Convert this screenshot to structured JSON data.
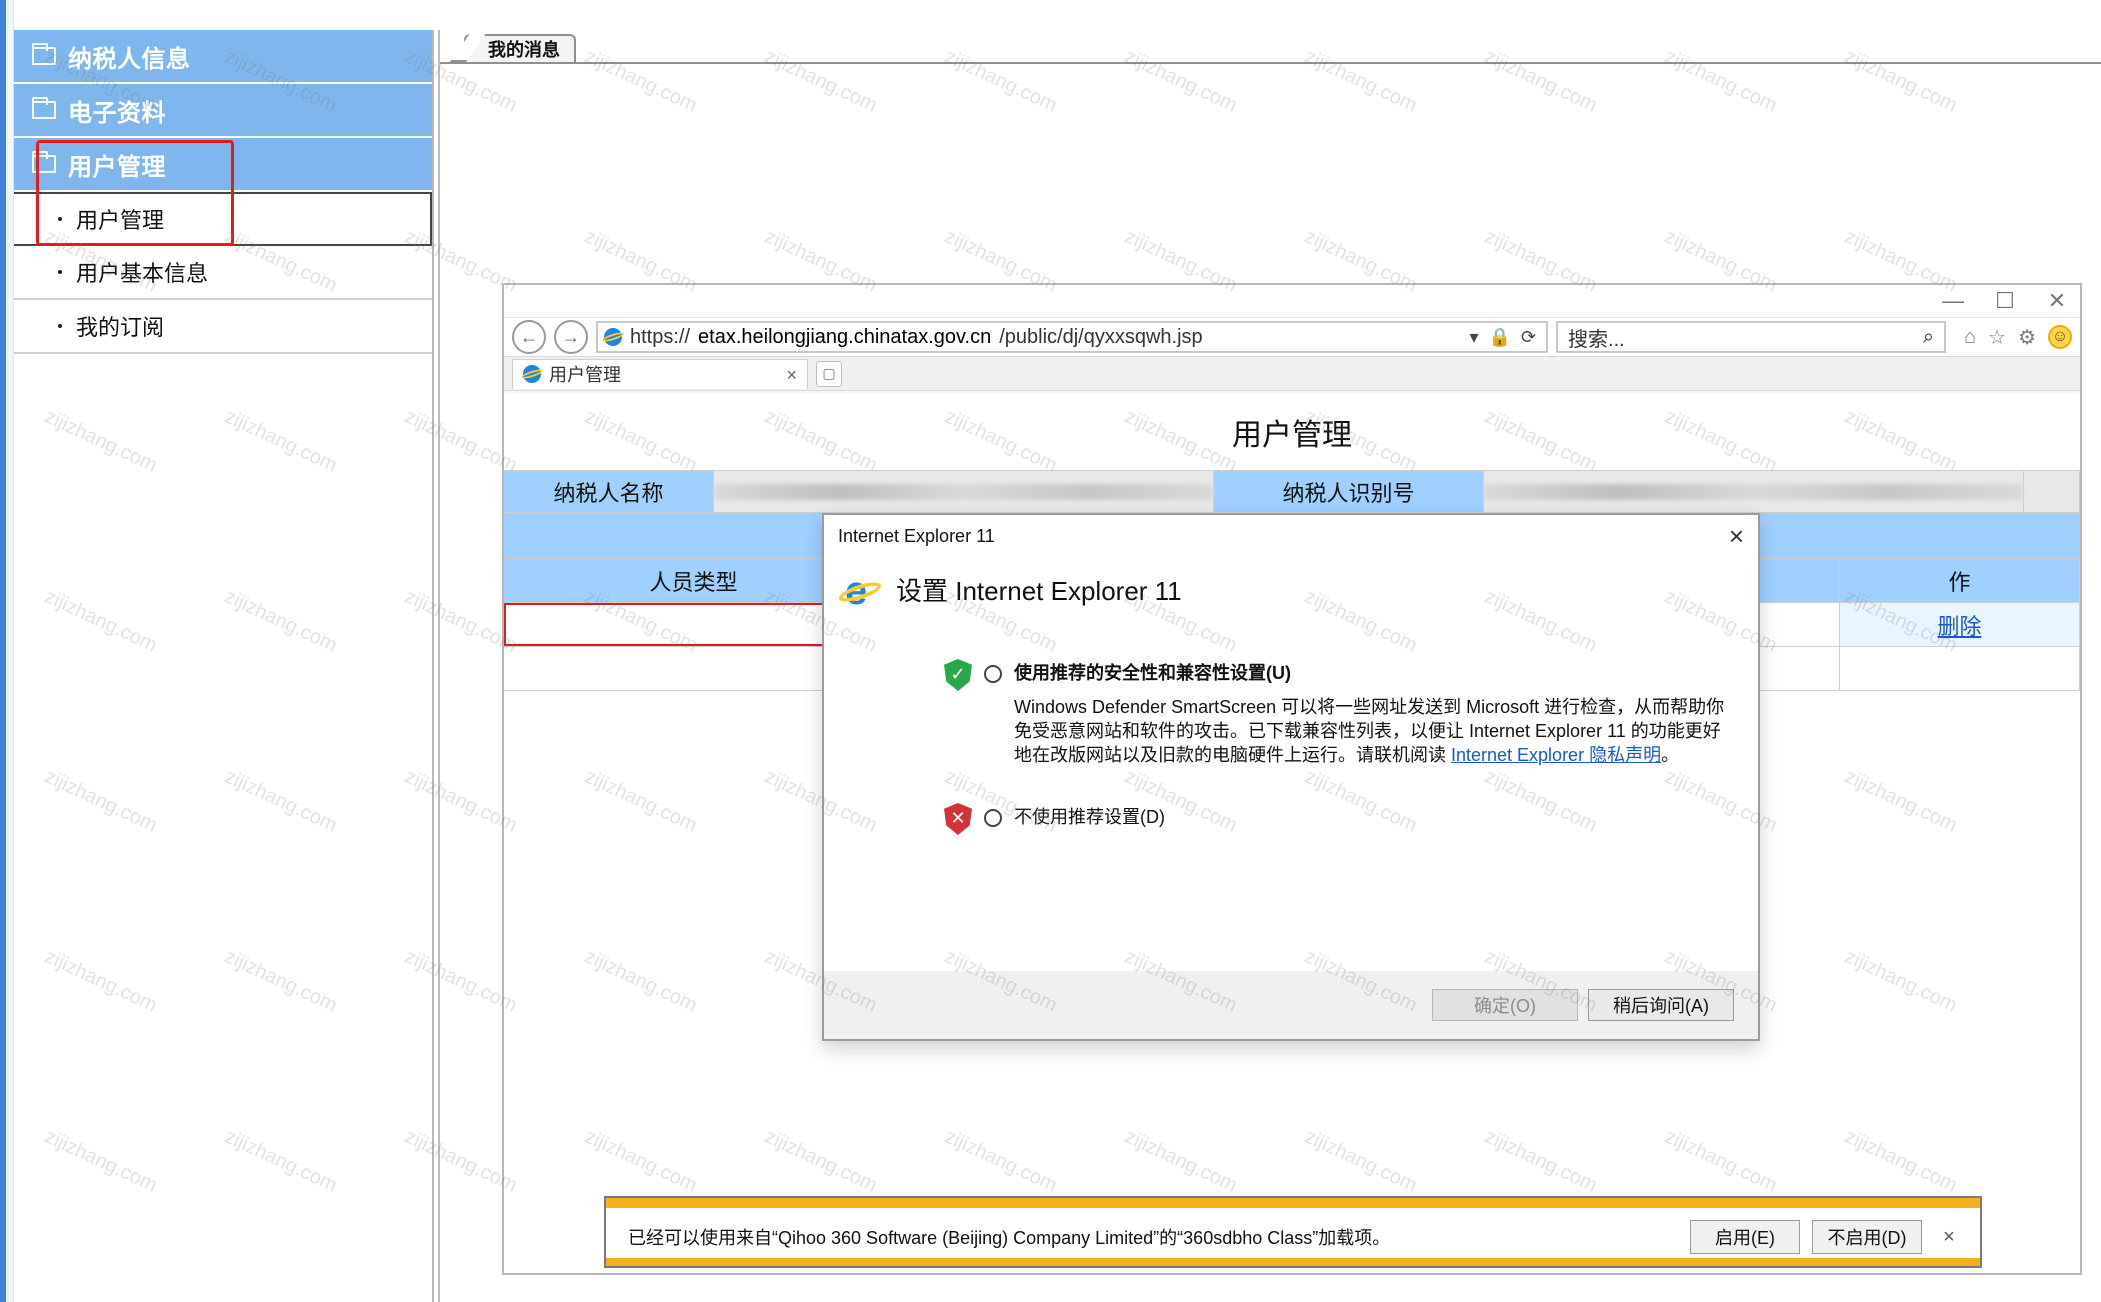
{
  "nav": {
    "headers": [
      {
        "label": "纳税人信息"
      },
      {
        "label": "电子资料"
      },
      {
        "label": "用户管理"
      }
    ],
    "subitems": [
      {
        "label": "用户管理",
        "active": true
      },
      {
        "label": "用户基本信息",
        "active": false
      },
      {
        "label": "我的订阅",
        "active": false
      }
    ]
  },
  "main": {
    "tab": "我的消息"
  },
  "browser": {
    "url_prefix": "https://",
    "url_host": "etax.heilongjiang.chinatax.gov.cn",
    "url_path": "/public/dj/qyxxsqwh.jsp",
    "search_placeholder": "搜索...",
    "tab_title": "用户管理"
  },
  "page": {
    "title": "用户管理",
    "fields": {
      "taxpayer_name_label": "纳税人名称",
      "taxpayer_id_label": "纳税人识别号"
    },
    "table": {
      "header_left": "人员类型",
      "header_right_partial": "作",
      "delete_link": "删除"
    }
  },
  "dialog": {
    "window_title": "Internet Explorer 11",
    "title": "设置 Internet Explorer 11",
    "option1_title": "使用推荐的安全性和兼容性设置(U)",
    "option1_text_before_link": "Windows Defender SmartScreen 可以将一些网址发送到 Microsoft 进行检查，从而帮助你免受恶意网站和软件的攻击。已下载兼容性列表，以便让 Internet Explorer 11 的功能更好地在改版网站以及旧款的电脑硬件上运行。请联机阅读 ",
    "option1_link": "Internet Explorer 隐私声明",
    "option1_text_after_link": "。",
    "option2_title": "不使用推荐设置(D)",
    "btn_ok": "确定(O)",
    "btn_later": "稍后询问(A)"
  },
  "addon_bar": {
    "message": "已经可以使用来自“Qihoo 360 Software (Beijing) Company Limited”的“360sdbho Class”加载项。",
    "btn_enable": "启用(E)",
    "btn_disable": "不启用(D)"
  },
  "watermark": {
    "text": "zijizhang.com"
  },
  "icons": {
    "ie": "ie-logo-icon",
    "folder": "folder-icon"
  },
  "colors": {
    "nav_blue": "#7fb6ee",
    "table_blue": "#9fd0ff",
    "highlight_red": "#e21b1b",
    "link_blue": "#1b58c8",
    "addon_yellow": "#f3b21d"
  }
}
